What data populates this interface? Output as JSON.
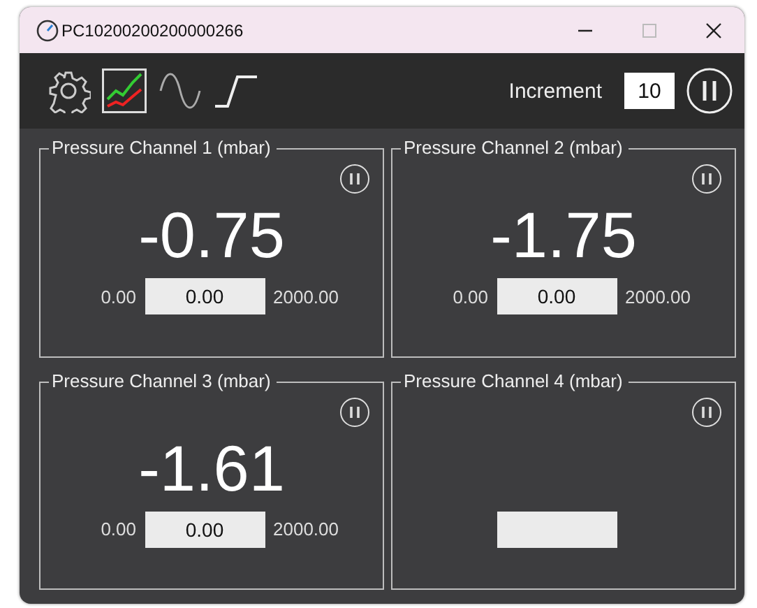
{
  "window": {
    "title": "PC10200200200000266"
  },
  "toolbar": {
    "tools": [
      {
        "kind": "gear",
        "selected": false
      },
      {
        "kind": "chart",
        "selected": true
      },
      {
        "kind": "sine",
        "selected": false
      },
      {
        "kind": "step",
        "selected": false
      }
    ],
    "increment_label": "Increment",
    "increment_value": "10"
  },
  "channels": [
    {
      "title": "Pressure Channel 1 (mbar)",
      "reading": "-0.75",
      "min": "0.00",
      "value": "0.00",
      "max": "2000.00"
    },
    {
      "title": "Pressure Channel 2 (mbar)",
      "reading": "-1.75",
      "min": "0.00",
      "value": "0.00",
      "max": "2000.00"
    },
    {
      "title": "Pressure Channel 3 (mbar)",
      "reading": "-1.61",
      "min": "0.00",
      "value": "0.00",
      "max": "2000.00"
    },
    {
      "title": "Pressure Channel 4 (mbar)"
    }
  ]
}
